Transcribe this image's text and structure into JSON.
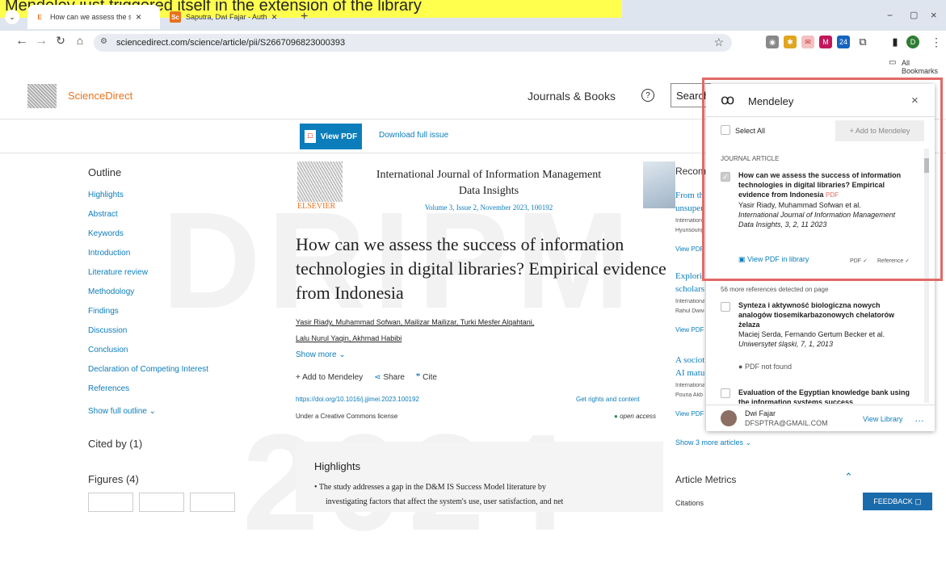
{
  "annotation": {
    "text": "Mendeley just triggered itself in the extension of the library"
  },
  "browser": {
    "tabs": [
      {
        "label": "How can we assess the success"
      },
      {
        "label": "Saputra, Dwi Fajar - Author det"
      }
    ],
    "url": "sciencedirect.com/science/article/pii/S2667096823000393",
    "bookmarks_label": "All Bookmarks",
    "ext_badge": "24"
  },
  "header": {
    "logo": "ScienceDirect",
    "journals_books": "Journals & Books",
    "help": "?",
    "search_label": "Search"
  },
  "toolbar": {
    "view_pdf": "View PDF",
    "download_issue": "Download full issue"
  },
  "outline": {
    "heading": "Outline",
    "items": [
      "Highlights",
      "Abstract",
      "Keywords",
      "Introduction",
      "Literature review",
      "Methodology",
      "Findings",
      "Discussion",
      "Conclusion",
      "Declaration of Competing Interest",
      "References"
    ],
    "show_full": "Show full outline",
    "cited_by": "Cited by (1)",
    "figures": "Figures (4)"
  },
  "journal": {
    "name": "International Journal of Information Management Data Insights",
    "volume": "Volume 3, Issue 2, November 2023, 100192",
    "publisher": "ELSEVIER"
  },
  "article": {
    "title": "How can we assess the success of information technologies in digital libraries? Empirical evidence from Indonesia",
    "authors_line1": "Yasir Riady, Muhammad Sofwan, Mailizar Mailizar, Turki Mesfer Alqahtani,",
    "authors_line2": "Lalu Nurul Yaqin, Akhmad Habibi",
    "show_more": "Show more",
    "add_mendeley": "Add to Mendeley",
    "share": "Share",
    "cite": "Cite",
    "doi": "https://doi.org/10.1016/j.jjimei.2023.100192",
    "rights": "Get rights and content",
    "license": "Under a Creative Commons license",
    "open_access": "open access",
    "highlights_heading": "Highlights",
    "highlight1a": "The study addresses a gap in the D&M IS Success Model literature by",
    "highlight1b": "investigating factors that affect the system's use, user satisfaction, and net"
  },
  "recommended": {
    "heading": "Recommended articles",
    "items": [
      {
        "t1": "From the",
        "t2": "unsuper",
        "src": "International",
        "auth": "Hyunsoung",
        "pdf": "View PDF"
      },
      {
        "t1": "Explorin",
        "t2": "scholarsh",
        "src": "International",
        "auth": "Rahul Dwive",
        "pdf": "View PDF"
      },
      {
        "t1": "A sociote",
        "t2": "AI maturi",
        "src": "International",
        "auth": "Pouria Akb",
        "pdf": "View PDF"
      }
    ],
    "show_more": "Show 3 more articles",
    "metrics": "Article Metrics",
    "citations": "Citations"
  },
  "watermark": {
    "top": "DRIPM",
    "bottom": "2024"
  },
  "mendeley": {
    "title": "Mendeley",
    "select_all": "Select All",
    "add_button": "+ Add to Mendeley",
    "type": "JOURNAL ARTICLE",
    "item_title": "How can we assess the success of information technologies in digital libraries? Empirical evidence from Indonesia",
    "pdf_tag": "PDF",
    "item_authors": "Yasir Riady, Muhammad Sofwan et al.",
    "item_source": "International Journal of Information Management Data Insights, 3, 2, 11 2023",
    "view_pdf_lib": "View PDF in library",
    "status_pdf": "PDF ✓",
    "status_ref": "Reference ✓",
    "more_refs": "56 more references detected on page",
    "item2_title": "Synteza i aktywność biologiczna nowych analogów tiosemikarbazonowych chelatorów żelaza",
    "item2_authors": "Maciej Serda, Fernando Gertum Becker et al.",
    "item2_source": "Uniwersytet śląski, 7, 1, 2013",
    "item2_pdf": "PDF not found",
    "item3_title": "Evaluation of the Egyptian knowledge bank using the information systems success",
    "user_name": "Dwi Fajar",
    "user_email": "DFSPTRA@GMAIL.COM",
    "view_library": "View Library"
  },
  "feedback": "FEEDBACK"
}
